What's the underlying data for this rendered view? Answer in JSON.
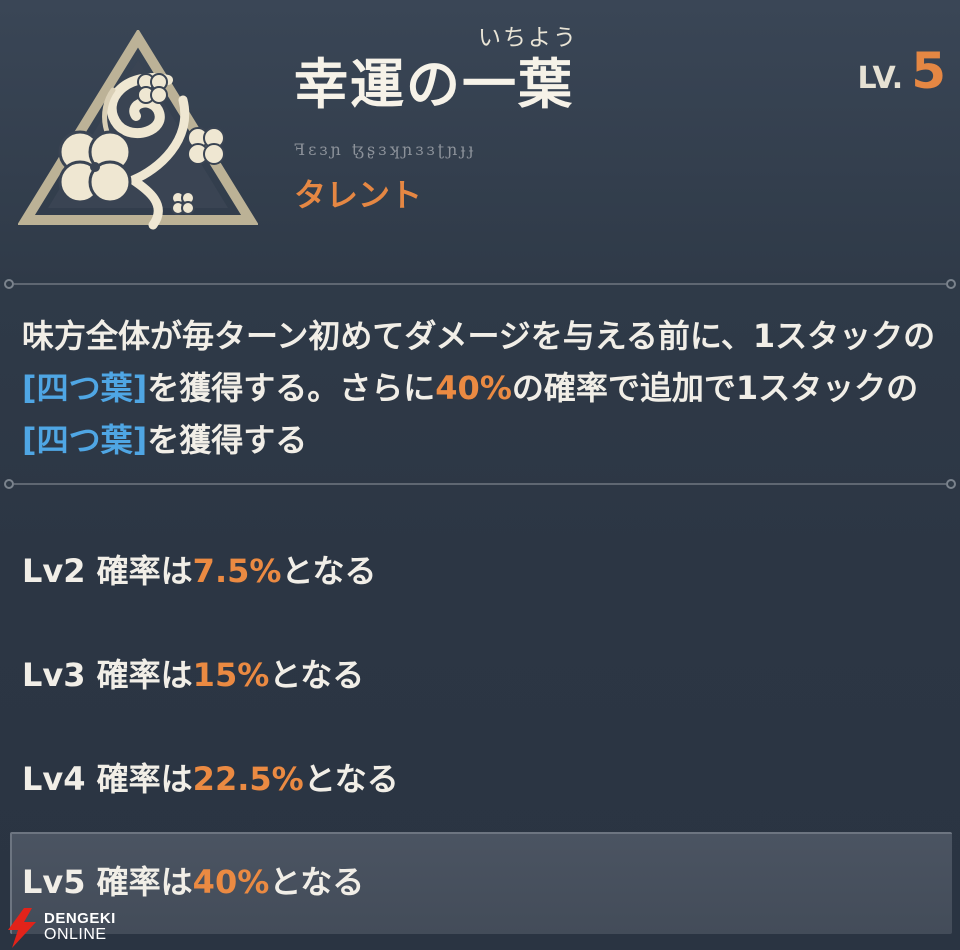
{
  "header": {
    "furigana": "いちよう",
    "title": "幸運の一葉",
    "level_label": "LV.",
    "level_value": "5",
    "runes": "ꟻɛɜɲ ꜩʂɜʞɲɜɜʈɲɟɟ",
    "category": "タレント",
    "emblem_icon": "four-leaf-clover-emblem-icon"
  },
  "description": {
    "seg1": "味方全体が毎ターン初めてダメージを与える前に、1スタックの",
    "kw1": "[四つ葉]",
    "seg2": "を獲得する。さらに",
    "pct": "40%",
    "seg3": "の確率で追加で1スタックの",
    "kw2": "[四つ葉]",
    "seg4": "を獲得する"
  },
  "levels": [
    {
      "label": "Lv2 確率は",
      "value": "7.5%",
      "suffix": "となる"
    },
    {
      "label": "Lv3 確率は",
      "value": "15%",
      "suffix": "となる"
    },
    {
      "label": "Lv4 確率は",
      "value": "22.5%",
      "suffix": "となる"
    },
    {
      "label": "Lv5 確率は",
      "value": "40%",
      "suffix": "となる"
    }
  ],
  "watermark": {
    "line1": "DENGEKI",
    "line2": "ONLINE"
  },
  "colors": {
    "accent_orange": "#eb8a42",
    "keyword_blue": "#4fa6e4",
    "background": "#2f3a48"
  }
}
